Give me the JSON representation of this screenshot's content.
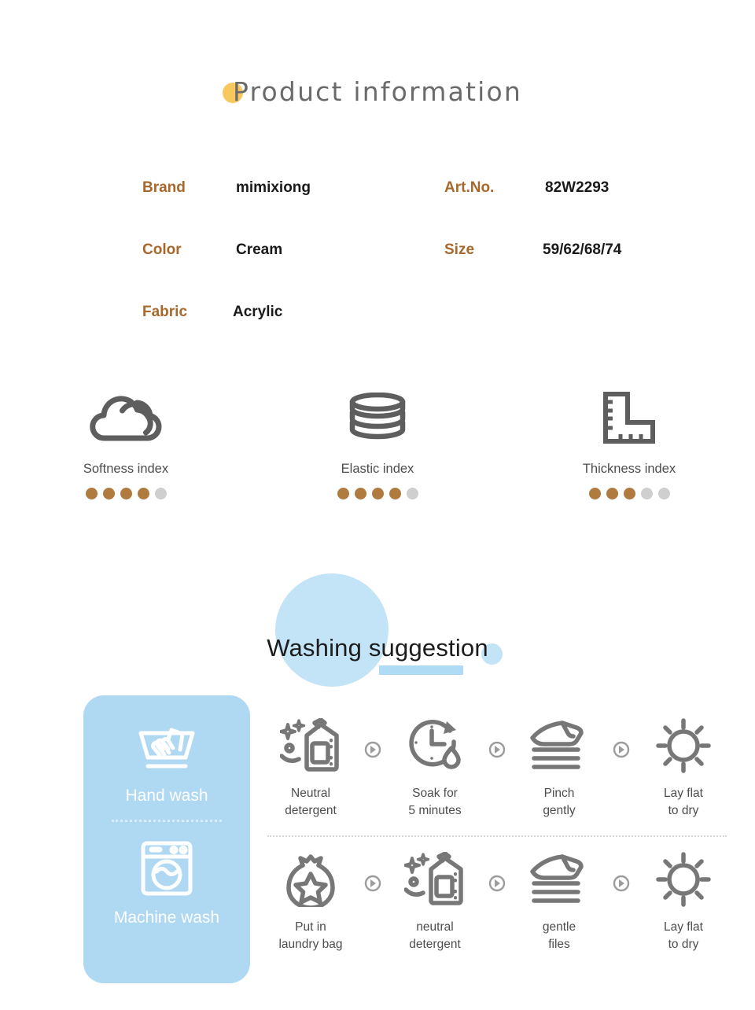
{
  "title": {
    "text": "Product information",
    "dot_color": "#F9C85C"
  },
  "specs": {
    "rows": [
      {
        "left": {
          "label": "Brand",
          "value": "mimixiong"
        },
        "right": {
          "label": "Art.No.",
          "value": "82W2293"
        }
      },
      {
        "left": {
          "label": "Color",
          "value": "Cream"
        },
        "right": {
          "label": "Size",
          "value": "59/62/68/74"
        }
      },
      {
        "left": {
          "label": "Fabric",
          "value": "Acrylic"
        },
        "right": {
          "label": "",
          "value": ""
        }
      }
    ],
    "label_color": "#A8682B",
    "value_color": "#1A1A1A"
  },
  "indices": [
    {
      "icon": "cloud-icon",
      "label": "Softness index",
      "filled": 4,
      "total": 5
    },
    {
      "icon": "coil-icon",
      "label": "Elastic index",
      "filled": 4,
      "total": 5
    },
    {
      "icon": "ruler-icon",
      "label": "Thickness index",
      "filled": 3,
      "total": 5
    }
  ],
  "index_colors": {
    "filled": "#B07B3F",
    "empty": "#CFCFCF"
  },
  "washing": {
    "heading": "Washing suggestion",
    "accent_color": "#AFD8F2",
    "modes": [
      {
        "icon": "hand-wash-icon",
        "label": "Hand wash"
      },
      {
        "icon": "machine-wash-icon",
        "label": "Machine wash"
      }
    ],
    "rows": [
      {
        "steps": [
          {
            "icon": "detergent-icon",
            "label": "Neutral\ndetergent"
          },
          {
            "icon": "clock-drop-icon",
            "label": "Soak for\n5 minutes"
          },
          {
            "icon": "pinch-hand-icon",
            "label": "Pinch\ngently"
          },
          {
            "icon": "sun-icon",
            "label": "Lay flat\nto dry"
          }
        ]
      },
      {
        "steps": [
          {
            "icon": "laundry-bag-icon",
            "label": "Put in\nlaundry bag"
          },
          {
            "icon": "detergent-icon",
            "label": "neutral\ndetergent"
          },
          {
            "icon": "pinch-hand-icon",
            "label": "gentle\nfiles"
          },
          {
            "icon": "sun-icon",
            "label": "Lay flat\nto dry"
          }
        ]
      }
    ]
  }
}
